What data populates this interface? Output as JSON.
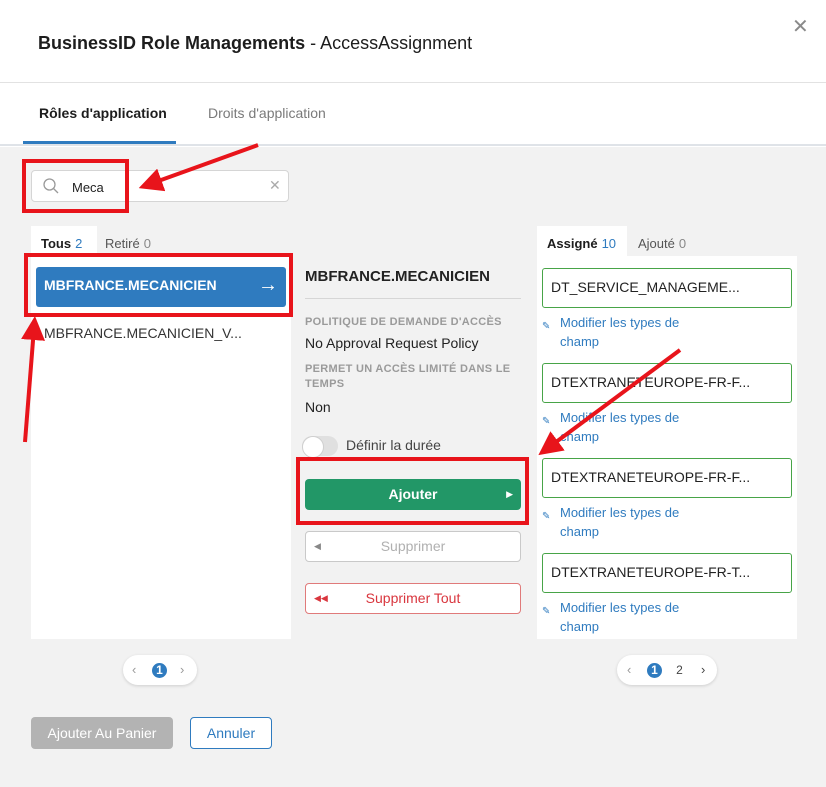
{
  "header": {
    "title_bold": "BusinessID Role Managements",
    "title_rest": " - AccessAssignment",
    "close_glyph": "✕"
  },
  "tabs": [
    {
      "label": "Rôles d'application"
    },
    {
      "label": "Droits d'application"
    }
  ],
  "search": {
    "value": "Meca",
    "clear_glyph": "✕"
  },
  "left": {
    "tabs": [
      {
        "label": "Tous",
        "count": "2"
      },
      {
        "label": "Retiré",
        "count": "0"
      }
    ],
    "items": [
      {
        "label": "MBFRANCE.MECANICIEN"
      },
      {
        "label": "MBFRANCE.MECANICIEN_V..."
      }
    ],
    "pager": {
      "pages": [
        "1"
      ],
      "current": "1"
    }
  },
  "detail": {
    "title": "MBFRANCE.MECANICIEN",
    "policy_label": "POLITIQUE DE DEMANDE D'ACCÈS",
    "policy_value": "No Approval Request Policy",
    "limited_label": "PERMET UN ACCÈS LIMITÉ DANS LE TEMPS",
    "limited_value": "Non",
    "toggle_label": "Définir la durée",
    "add_label": "Ajouter",
    "remove_label": "Supprimer",
    "remove_all_label": "Supprimer Tout"
  },
  "right": {
    "tabs": [
      {
        "label": "Assigné",
        "count": "10"
      },
      {
        "label": "Ajouté",
        "count": "0"
      }
    ],
    "items": [
      {
        "label": "DT_SERVICE_MANAGEME...",
        "edit": "Modifier les types de champ"
      },
      {
        "label": "DTEXTRANETEUROPE-FR-F...",
        "edit": "Modifier les types de champ"
      },
      {
        "label": "DTEXTRANETEUROPE-FR-F...",
        "edit": "Modifier les types de champ"
      },
      {
        "label": "DTEXTRANETEUROPE-FR-T...",
        "edit": "Modifier les types de champ"
      }
    ],
    "pager": {
      "pages": [
        "1",
        "2"
      ],
      "current": "1"
    }
  },
  "footer": {
    "cart_label": "Ajouter Au Panier",
    "cancel_label": "Annuler"
  },
  "colors": {
    "accent": "#2f7bbf",
    "add_green": "#229767",
    "danger": "#d9363e",
    "annotation_red": "#e8141b",
    "assigned_border": "#47a447"
  }
}
